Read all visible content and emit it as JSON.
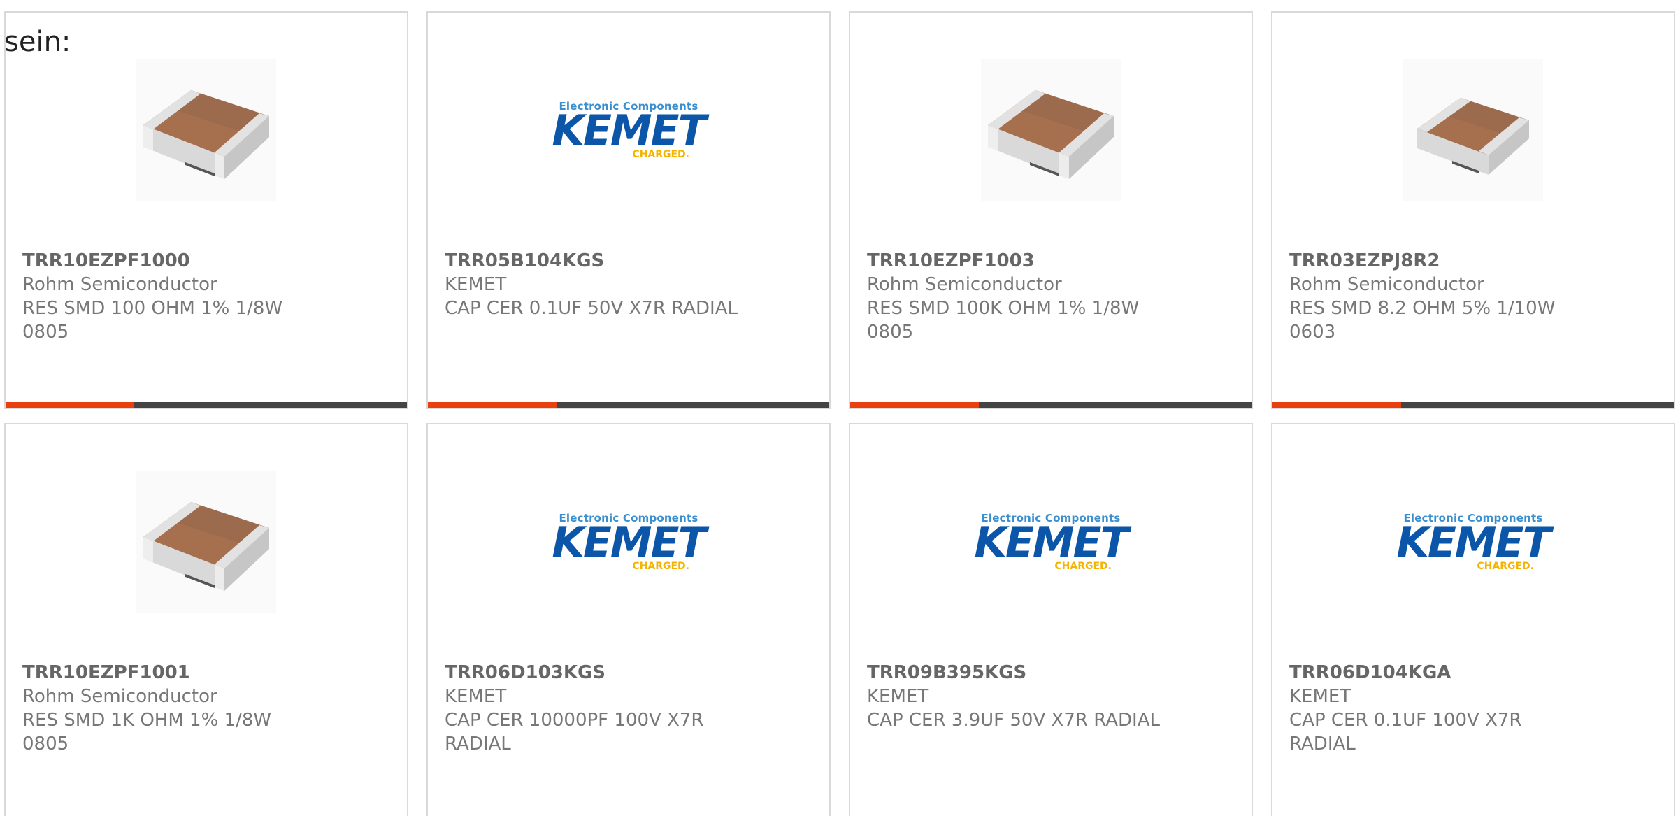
{
  "intro_text": "sein:",
  "colors": {
    "accent": "#e8410f",
    "bar_track": "#444444",
    "card_border": "#d9d9d9",
    "text": "#777777",
    "kemet_blue": "#0b56a8",
    "kemet_light_blue": "#3a8fd0",
    "kemet_yellow": "#f4b400"
  },
  "products": [
    {
      "part_number": "TRR10EZPF1000",
      "manufacturer": "Rohm Semiconductor",
      "description_line1": "RES SMD 100 OHM 1% 1/8W",
      "description_line2": "0805",
      "image": "smd-resistor-icon",
      "progress": 0.32
    },
    {
      "part_number": "TRR05B104KGS",
      "manufacturer": "KEMET",
      "description_line1": "CAP CER 0.1UF 50V X7R RADIAL",
      "description_line2": "",
      "image": "kemet-logo",
      "progress": 0.32
    },
    {
      "part_number": "TRR10EZPF1003",
      "manufacturer": "Rohm Semiconductor",
      "description_line1": "RES SMD 100K OHM 1% 1/8W",
      "description_line2": "0805",
      "image": "smd-resistor-icon",
      "progress": 0.32
    },
    {
      "part_number": "TRR03EZPJ8R2",
      "manufacturer": "Rohm Semiconductor",
      "description_line1": "RES SMD 8.2 OHM 5% 1/10W",
      "description_line2": "0603",
      "image": "smd-resistor-icon",
      "progress": 0.32
    },
    {
      "part_number": "TRR10EZPF1001",
      "manufacturer": "Rohm Semiconductor",
      "description_line1": "RES SMD 1K OHM 1% 1/8W 0805",
      "description_line2": "",
      "image": "smd-resistor-icon"
    },
    {
      "part_number": "TRR06D103KGS",
      "manufacturer": "KEMET",
      "description_line1": "CAP CER 10000PF 100V X7R",
      "description_line2": "RADIAL",
      "image": "kemet-logo"
    },
    {
      "part_number": "TRR09B395KGS",
      "manufacturer": "KEMET",
      "description_line1": "CAP CER 3.9UF 50V X7R RADIAL",
      "description_line2": "",
      "image": "kemet-logo"
    },
    {
      "part_number": "TRR06D104KGA",
      "manufacturer": "KEMET",
      "description_line1": "CAP CER 0.1UF 100V X7R RADIAL",
      "description_line2": "",
      "image": "kemet-logo"
    }
  ],
  "kemet_logo": {
    "tagline": "Electronic Components",
    "wordmark": "KEMET",
    "sub": "CHARGED."
  }
}
